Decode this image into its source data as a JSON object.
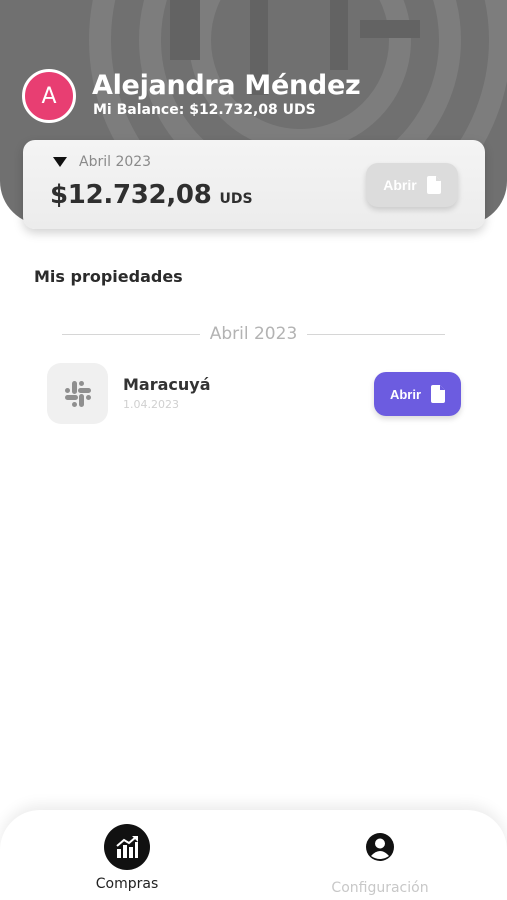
{
  "colors": {
    "header_bg": "#707070",
    "avatar_bg": "#e83e72",
    "primary_button": "#6c5ce0",
    "disabled_button": "#dcdcdc",
    "nav_active": "#111111",
    "nav_inactive": "#c8c8c8"
  },
  "profile": {
    "avatar_initial": "A",
    "name": "Alejandra Méndez",
    "balance_line": "Mi Balance: $12.732,08 UDS"
  },
  "balance_card": {
    "period_icon": "caret-down-icon",
    "period": "Abril 2023",
    "amount": "$12.732,08",
    "currency": "UDS",
    "open_label": "Abrir",
    "open_icon": "document-icon"
  },
  "properties": {
    "title": "Mis propiedades",
    "groups": [
      {
        "month": "Abril 2023",
        "items": [
          {
            "logo_icon": "slack-logo-icon",
            "name": "Maracuyá",
            "date": "1.04.2023",
            "open_label": "Abrir",
            "open_icon": "document-icon"
          }
        ]
      }
    ]
  },
  "bottom_nav": {
    "items": [
      {
        "label": "Compras",
        "icon": "chart-growth-icon",
        "active": true
      },
      {
        "label": "Configuración",
        "icon": "user-circle-icon",
        "active": false
      }
    ]
  }
}
